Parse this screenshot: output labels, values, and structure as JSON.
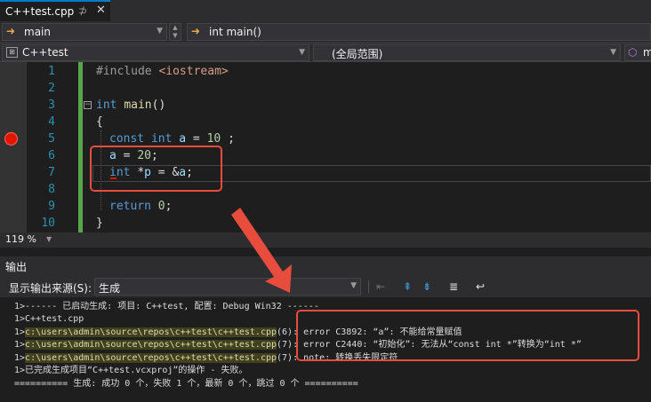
{
  "tab": {
    "title": "C++test.cpp",
    "pin": "⊅",
    "close": "✕"
  },
  "navbar": {
    "scope_combo": "main",
    "member_combo": "int main()"
  },
  "scopebar": {
    "project": "C++test",
    "scope": "(全局范围)",
    "extra": "m"
  },
  "editor": {
    "line_numbers": [
      "1",
      "2",
      "3",
      "4",
      "5",
      "6",
      "7",
      "8",
      "9",
      "10"
    ],
    "lines": [
      {
        "pre": "#include ",
        "str": "<iostream>"
      },
      {},
      {
        "kw": "int ",
        "fn": "main",
        "rest": "()"
      },
      {
        "rest": "{"
      },
      {
        "kw": "const int ",
        "var": "a",
        "rest": " = ",
        "num": "10",
        "tail": " ;"
      },
      {
        "var": "a",
        "rest": " = ",
        "num": "20",
        "tail": ";"
      },
      {
        "kw": "int ",
        "rest": "*",
        "var": "p",
        "mid": " = &",
        "var2": "a",
        "tail": ";"
      },
      {},
      {
        "kw": "return ",
        "num": "0",
        "tail": ";"
      },
      {
        "rest": "}"
      }
    ]
  },
  "zoom": {
    "level": "119 %"
  },
  "output": {
    "title": "输出",
    "source_label": "显示输出来源(S):",
    "source_value": "生成",
    "lines": [
      {
        "text": "1>------ 已启动生成: 项目: C++test, 配置: Debug Win32 ------"
      },
      {
        "text": "1>C++test.cpp"
      },
      {
        "prefix": "1>",
        "path": "c:\\users\\admin\\source\\repos\\c++test\\c++test.cpp",
        "loc": "(6): ",
        "msg": "error C3892: “a”: 不能给常量赋值"
      },
      {
        "prefix": "1>",
        "path": "c:\\users\\admin\\source\\repos\\c++test\\c++test.cpp",
        "loc": "(7): ",
        "msg": "error C2440: “初始化”: 无法从“const int *”转换为“int *”"
      },
      {
        "prefix": "1>",
        "path": "c:\\users\\admin\\source\\repos\\c++test\\c++test.cpp",
        "loc": "(7): ",
        "msg": "note: 转换丢失限定符"
      },
      {
        "text": "1>已完成生成项目“C++test.vcxproj”的操作 - 失败。"
      },
      {
        "text": "========== 生成: 成功 0 个，失败 1 个，最新 0 个，跳过 0 个 =========="
      }
    ]
  },
  "colors": {
    "annotation": "#e74c3c",
    "breakpoint": "#e51400",
    "accent": "#007acc"
  }
}
